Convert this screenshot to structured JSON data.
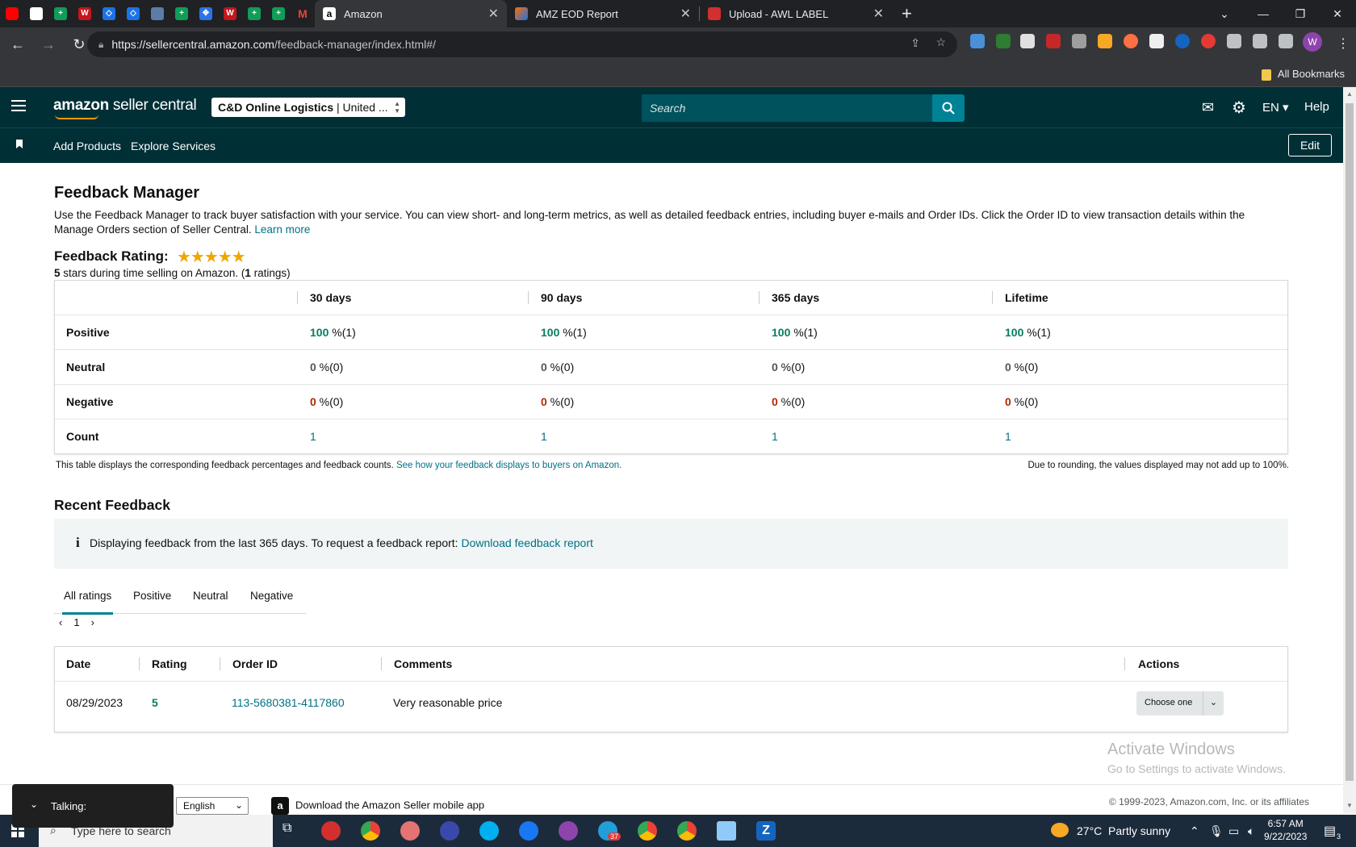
{
  "browser": {
    "tabs": [
      {
        "title": "Amazon",
        "active": true
      },
      {
        "title": "AMZ EOD Report",
        "active": false
      },
      {
        "title": "Upload - AWL LABEL",
        "active": false
      }
    ],
    "url_host": "https://sellercentral.amazon.com",
    "url_path": "/feedback-manager/index.html#/",
    "all_bookmarks": "All Bookmarks",
    "profile_initial": "W"
  },
  "header": {
    "logo_amazon": "amazon",
    "logo_rest": " seller central",
    "account_name": "C&D Online Logistics",
    "account_region": " | United ...",
    "search_placeholder": "Search",
    "language": "EN",
    "help": "Help"
  },
  "nav": {
    "add_products": "Add Products",
    "explore_services": "Explore Services",
    "edit": "Edit"
  },
  "page": {
    "title": "Feedback Manager",
    "intro": "Use the Feedback Manager to track buyer satisfaction with your service. You can view short- and long-term metrics, as well as detailed feedback entries, including buyer e-mails and Order IDs. Click the Order ID to view transaction details within the Manage Orders section of Seller Central.",
    "learn_more": "Learn more",
    "rating_label": "Feedback Rating:",
    "stars": "★★★★★",
    "rating_stars": "5",
    "rating_text_mid": " stars during time selling on Amazon. (",
    "rating_count": "1",
    "rating_text_end": " ratings)"
  },
  "feedback_table": {
    "columns": [
      "30 days",
      "90 days",
      "365 days",
      "Lifetime"
    ],
    "rows": [
      {
        "label": "Positive",
        "values": [
          "100",
          "100",
          "100",
          "100"
        ],
        "suffix": " %(1)"
      },
      {
        "label": "Neutral",
        "values": [
          "0",
          "0",
          "0",
          "0"
        ],
        "suffix": " %(0)"
      },
      {
        "label": "Negative",
        "values": [
          "0",
          "0",
          "0",
          "0"
        ],
        "suffix": " %(0)"
      },
      {
        "label": "Count",
        "values": [
          "1",
          "1",
          "1",
          "1"
        ],
        "suffix": ""
      }
    ],
    "note_left": "This table displays the corresponding feedback percentages and feedback counts.",
    "note_link": "See how your feedback displays to buyers on Amazon.",
    "note_right": "Due to rounding, the values displayed may not add up to 100%."
  },
  "recent": {
    "title": "Recent Feedback",
    "info_text": "Displaying feedback from the last 365 days. To request a feedback report:",
    "info_link": "Download feedback report",
    "tabs": [
      "All ratings",
      "Positive",
      "Neutral",
      "Negative"
    ],
    "page": "1",
    "columns": [
      "Date",
      "Rating",
      "Order ID",
      "Comments",
      "Actions"
    ],
    "rows": [
      {
        "date": "08/29/2023",
        "rating": "5",
        "order_id": "113-5680381-4117860",
        "comment": "Very reasonable price",
        "action": "Choose one"
      }
    ]
  },
  "watermark": {
    "line1": "Activate Windows",
    "line2": "Go to Settings to activate Windows."
  },
  "footer": {
    "language": "English",
    "app_download": "Download the Amazon Seller mobile app",
    "copyright": "© 1999-2023, Amazon.com, Inc. or its affiliates",
    "talking": "Talking:"
  },
  "taskbar": {
    "search_placeholder": "Type here to search",
    "weather": "27°C  Partly sunny",
    "time": "6:57 AM",
    "date": "9/22/2023",
    "badge_telegram": "37",
    "notif_count": "3"
  }
}
